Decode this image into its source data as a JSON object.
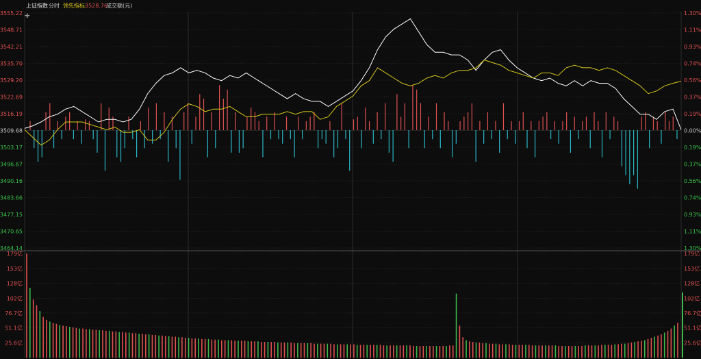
{
  "header": {
    "index_name": "上证指数",
    "period": "分时",
    "lead_label": "领先指标:",
    "lead_value": "3528.76",
    "volume_label": "成交额(元)"
  },
  "colors": {
    "background": "#0d0d0d",
    "grid": "#3a3a3a",
    "up": "#e05050",
    "down": "#2bb6c8",
    "price_line": "#ffffff",
    "lead_line": "#d8c81a",
    "vol_up": "#e05050",
    "vol_down": "#3fb84a",
    "label_up": "#e05050",
    "label_down": "#39c24a",
    "label_neutral": "#c8c8c8"
  },
  "chart_data": [
    {
      "type": "line",
      "title": "",
      "price_axis": [
        3555.22,
        3548.71,
        3542.21,
        3535.7,
        3529.2,
        3522.69,
        3516.19,
        3509.68,
        3503.17,
        3496.67,
        3490.16,
        3483.66,
        3477.15,
        3470.65,
        3464.14
      ],
      "price_axis_labels": [
        "3555.22",
        "3548.71",
        "3542.21",
        "3535.70",
        "3529.20",
        "3522.69",
        "3516.19",
        "3509.68",
        "3503.17",
        "3496.67",
        "3490.16",
        "3483.66",
        "3477.15",
        "3470.65",
        "3464.14"
      ],
      "pct_axis_labels": [
        "1.30%",
        "1.11%",
        "0.93%",
        "0.74%",
        "0.56%",
        "0.37%",
        "0.19%",
        "0.00%",
        "0.19%",
        "0.37%",
        "0.56%",
        "0.74%",
        "0.93%",
        "1.11%",
        "1.30%"
      ],
      "ylim": [
        3464.14,
        3555.22
      ],
      "prev_close": 3509.68,
      "x_minutes": [
        0,
        240
      ],
      "series": [
        {
          "points": [
            [
              0,
              3510.5
            ],
            [
              3,
              3511.5
            ],
            [
              6,
              3513
            ],
            [
              9,
              3515
            ],
            [
              12,
              3516
            ],
            [
              15,
              3518
            ],
            [
              18,
              3519
            ],
            [
              21,
              3517
            ],
            [
              24,
              3515
            ],
            [
              27,
              3513
            ],
            [
              30,
              3514
            ],
            [
              33,
              3514
            ],
            [
              36,
              3513
            ],
            [
              39,
              3514
            ],
            [
              42,
              3518
            ],
            [
              45,
              3524
            ],
            [
              48,
              3528
            ],
            [
              51,
              3531
            ],
            [
              54,
              3532
            ],
            [
              57,
              3534
            ],
            [
              60,
              3532
            ],
            [
              63,
              3533
            ],
            [
              66,
              3532
            ],
            [
              69,
              3530
            ],
            [
              72,
              3529
            ],
            [
              75,
              3531
            ],
            [
              78,
              3530
            ],
            [
              81,
              3532
            ],
            [
              84,
              3530
            ],
            [
              87,
              3528
            ],
            [
              90,
              3526
            ],
            [
              93,
              3524
            ],
            [
              96,
              3522
            ],
            [
              99,
              3524
            ],
            [
              102,
              3522
            ],
            [
              105,
              3521
            ],
            [
              108,
              3521
            ],
            [
              111,
              3519
            ],
            [
              114,
              3521
            ],
            [
              117,
              3523
            ],
            [
              120,
              3525
            ],
            [
              123,
              3529
            ],
            [
              126,
              3534
            ],
            [
              129,
              3541
            ],
            [
              132,
              3546
            ],
            [
              135,
              3549
            ],
            [
              138,
              3551
            ],
            [
              141,
              3553
            ],
            [
              144,
              3548
            ],
            [
              147,
              3543
            ],
            [
              150,
              3540
            ],
            [
              153,
              3540
            ],
            [
              156,
              3539
            ],
            [
              159,
              3539
            ],
            [
              162,
              3537
            ],
            [
              165,
              3533
            ],
            [
              168,
              3537
            ],
            [
              171,
              3540
            ],
            [
              174,
              3541
            ],
            [
              177,
              3537
            ],
            [
              180,
              3534
            ],
            [
              183,
              3532
            ],
            [
              186,
              3530
            ],
            [
              189,
              3529
            ],
            [
              192,
              3530
            ],
            [
              195,
              3528
            ],
            [
              198,
              3527
            ],
            [
              201,
              3529
            ],
            [
              204,
              3527
            ],
            [
              207,
              3529
            ],
            [
              210,
              3528
            ],
            [
              213,
              3528
            ],
            [
              216,
              3526
            ],
            [
              219,
              3522
            ],
            [
              222,
              3519
            ],
            [
              225,
              3516
            ],
            [
              228,
              3516
            ],
            [
              231,
              3514
            ],
            [
              234,
              3517
            ],
            [
              237,
              3518
            ],
            [
              240,
              3510
            ]
          ]
        },
        {
          "points": [
            [
              0,
              3510
            ],
            [
              3,
              3507
            ],
            [
              6,
              3504
            ],
            [
              9,
              3506
            ],
            [
              12,
              3510
            ],
            [
              15,
              3513
            ],
            [
              18,
              3513
            ],
            [
              21,
              3513
            ],
            [
              24,
              3512
            ],
            [
              27,
              3511
            ],
            [
              30,
              3510
            ],
            [
              33,
              3511
            ],
            [
              36,
              3509
            ],
            [
              39,
              3509
            ],
            [
              42,
              3510
            ],
            [
              45,
              3506
            ],
            [
              48,
              3506
            ],
            [
              51,
              3509
            ],
            [
              54,
              3514
            ],
            [
              57,
              3518
            ],
            [
              60,
              3520
            ],
            [
              63,
              3519
            ],
            [
              66,
              3517
            ],
            [
              69,
              3518
            ],
            [
              72,
              3518
            ],
            [
              75,
              3519
            ],
            [
              78,
              3517
            ],
            [
              81,
              3515
            ],
            [
              84,
              3515
            ],
            [
              87,
              3516
            ],
            [
              90,
              3516
            ],
            [
              93,
              3516
            ],
            [
              96,
              3517
            ],
            [
              99,
              3516
            ],
            [
              102,
              3517
            ],
            [
              105,
              3517
            ],
            [
              108,
              3514
            ],
            [
              111,
              3515
            ],
            [
              114,
              3519
            ],
            [
              117,
              3521
            ],
            [
              120,
              3523
            ],
            [
              123,
              3527
            ],
            [
              126,
              3529
            ],
            [
              129,
              3534
            ],
            [
              132,
              3532
            ],
            [
              135,
              3530
            ],
            [
              138,
              3528
            ],
            [
              141,
              3527
            ],
            [
              144,
              3528
            ],
            [
              147,
              3530
            ],
            [
              150,
              3531
            ],
            [
              153,
              3530
            ],
            [
              156,
              3532
            ],
            [
              159,
              3533
            ],
            [
              162,
              3533
            ],
            [
              165,
              3534
            ],
            [
              168,
              3537
            ],
            [
              171,
              3536
            ],
            [
              174,
              3535
            ],
            [
              177,
              3533
            ],
            [
              180,
              3532
            ],
            [
              183,
              3531
            ],
            [
              186,
              3530
            ],
            [
              189,
              3532
            ],
            [
              192,
              3532
            ],
            [
              195,
              3531
            ],
            [
              198,
              3534
            ],
            [
              201,
              3535
            ],
            [
              204,
              3534
            ],
            [
              207,
              3534
            ],
            [
              210,
              3533
            ],
            [
              213,
              3534
            ],
            [
              216,
              3533
            ],
            [
              219,
              3531
            ],
            [
              222,
              3529
            ],
            [
              225,
              3527
            ],
            [
              228,
              3524
            ],
            [
              231,
              3525
            ],
            [
              234,
              3527
            ],
            [
              237,
              3528
            ],
            [
              240,
              3528.76
            ]
          ]
        }
      ]
    },
    {
      "type": "bar",
      "title": "",
      "note": "strength bars around the 0.00% baseline, values in % (positive red, negative cyan)",
      "x_minutes": [
        0,
        240
      ],
      "values": [
        0.1,
        -0.2,
        -0.35,
        -0.3,
        0.2,
        0.3,
        -0.2,
        0.1,
        -0.1,
        0.15,
        0.2,
        -0.1,
        0.1,
        -0.15,
        0.12,
        0.1,
        -0.1,
        -0.25,
        0.3,
        -0.45,
        0.25,
        0.15,
        -0.3,
        -0.35,
        -0.2,
        0.15,
        -0.1,
        -0.3,
        0.1,
        -0.2,
        0.25,
        -0.15,
        0.3,
        -0.1,
        0.2,
        -0.35,
        0.15,
        -0.2,
        -0.55,
        0.2,
        0.3,
        -0.15,
        0.15,
        0.4,
        0.35,
        -0.3,
        0.2,
        -0.2,
        0.5,
        0.35,
        0.45,
        -0.25,
        0.2,
        -0.25,
        -0.2,
        0.15,
        0.25,
        0.2,
        0.1,
        -0.3,
        0.15,
        -0.1,
        0.2,
        -0.1,
        -0.15,
        0.15,
        -0.1,
        -0.3,
        0.15,
        -0.1,
        0.1,
        0.15,
        0.2,
        -0.2,
        -0.1,
        -0.15,
        0.1,
        -0.3,
        -0.2,
        0.3,
        -0.1,
        -0.45,
        0.12,
        0.15,
        -0.2,
        0.25,
        0.1,
        -0.15,
        0.2,
        -0.1,
        0.3,
        -0.25,
        -0.35,
        0.4,
        0.15,
        0.3,
        -0.2,
        0.5,
        0.45,
        0.3,
        -0.2,
        0.15,
        -0.1,
        0.3,
        -0.2,
        0.2,
        0.1,
        -0.3,
        -0.15,
        0.1,
        0.15,
        0.2,
        0.3,
        -0.35,
        0.1,
        -0.15,
        0.2,
        -0.1,
        0.1,
        -0.25,
        0.3,
        -0.1,
        0.1,
        -0.15,
        0.1,
        0.2,
        -0.2,
        0.1,
        -0.3,
        0.1,
        0.15,
        0.2,
        -0.1,
        0.1,
        -0.15,
        0.1,
        0.2,
        -0.25,
        0.15,
        -0.1,
        0.1,
        0.15,
        -0.2,
        0.2,
        0.1,
        -0.3,
        0.2,
        -0.1,
        0.15,
        0.1,
        -0.4,
        -0.5,
        -0.6,
        -0.5,
        -0.65,
        0.15,
        0.2,
        -0.2,
        0.15,
        0.1,
        -0.15,
        0.2,
        0.1,
        0.15,
        -0.1
      ],
      "ylim": [
        -1.3,
        1.3
      ]
    },
    {
      "type": "bar",
      "title": "",
      "ylabel": "成交额(元)",
      "volume_axis_labels": [
        "179亿",
        "153亿",
        "128亿",
        "102亿",
        "76.7亿",
        "51.1亿",
        "25.6亿"
      ],
      "volume_axis_values": [
        179,
        153,
        128,
        102,
        76.7,
        51.1,
        25.6
      ],
      "ylim": [
        0,
        179
      ],
      "unit": "亿",
      "x_minutes": [
        0,
        240
      ],
      "values": [
        179,
        120,
        100,
        90,
        80,
        70,
        65,
        62,
        60,
        58,
        56,
        55,
        54,
        53,
        52,
        51,
        50,
        50,
        49,
        49,
        48,
        48,
        47,
        47,
        46,
        46,
        45,
        45,
        44,
        44,
        43,
        43,
        42,
        42,
        41,
        41,
        40,
        40,
        39,
        39,
        38,
        38,
        37,
        37,
        36,
        36,
        35,
        35,
        34,
        34,
        33,
        33,
        33,
        32,
        32,
        32,
        31,
        31,
        31,
        30,
        30,
        30,
        30,
        29,
        29,
        29,
        29,
        28,
        28,
        28,
        28,
        27,
        27,
        27,
        27,
        27,
        26,
        26,
        26,
        26,
        26,
        25,
        25,
        25,
        25,
        25,
        25,
        24,
        24,
        24,
        24,
        24,
        24,
        23,
        23,
        23,
        23,
        23,
        23,
        23,
        22,
        22,
        22,
        22,
        22,
        22,
        22,
        22,
        21,
        21,
        21,
        21,
        21,
        21,
        21,
        21,
        21,
        20,
        20,
        20,
        20,
        20,
        20,
        20,
        20,
        20,
        20,
        20,
        21,
        21,
        110,
        55,
        35,
        30,
        28,
        27,
        26,
        26,
        25,
        25,
        24,
        24,
        24,
        23,
        23,
        23,
        23,
        22,
        22,
        22,
        22,
        22,
        22,
        21,
        21,
        21,
        21,
        21,
        21,
        21,
        21,
        20,
        20,
        20,
        20,
        20,
        20,
        20,
        20,
        21,
        21,
        21,
        21,
        21,
        22,
        22,
        22,
        22,
        23,
        23,
        24,
        24,
        25,
        26,
        27,
        28,
        29,
        30,
        32,
        34,
        36,
        38,
        40,
        43,
        46,
        50,
        55,
        60
      ],
      "last_bar": 112
    }
  ]
}
